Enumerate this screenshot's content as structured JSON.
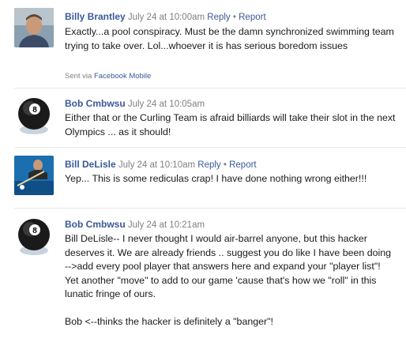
{
  "comments": [
    {
      "author": "Billy Brantley",
      "time": "July 24 at 10:00am",
      "actions": [
        "Reply",
        "Report"
      ],
      "text": "Exactly...a pool conspiracy. Must be the damn synchronized swimming team trying to take over. Lol...whoever it is has serious boredom issues",
      "sent_via_prefix": "Sent via",
      "sent_via_link": "Facebook Mobile"
    },
    {
      "author": "Bob Cmbwsu",
      "time": "July 24 at 10:05am",
      "actions": [],
      "text": "Either that or the Curling Team is afraid billiards will take their slot in the next Olympics ... as it should!"
    },
    {
      "author": "Bill DeLisle",
      "time": "July 24 at 10:10am",
      "actions": [
        "Reply",
        "Report"
      ],
      "text": "Yep... This is some rediculas crap! I have done nothing wrong either!!!"
    },
    {
      "author": "Bob Cmbwsu",
      "time": "July 24 at 10:21am",
      "actions": [],
      "text": "Bill DeLisle-- I never thought I would air-barrel anyone, but this hacker deserves it. We are already friends .. suggest you do like I have been doing -->add every pool player that answers here and expand your \"player list\"! Yet another \"move\" to add to our game 'cause that's how we \"roll\" in this lunatic fringe of ours.\n\nBob <--thinks the hacker is definitely a \"banger\"!"
    }
  ],
  "avatars": [
    "person-photo",
    "eight-ball-icon",
    "pool-table-photo",
    "eight-ball-icon"
  ],
  "colors": {
    "link": "#3b5998",
    "meta": "#808080",
    "text": "#1a1a1a",
    "separator": "#e6e9ef"
  }
}
